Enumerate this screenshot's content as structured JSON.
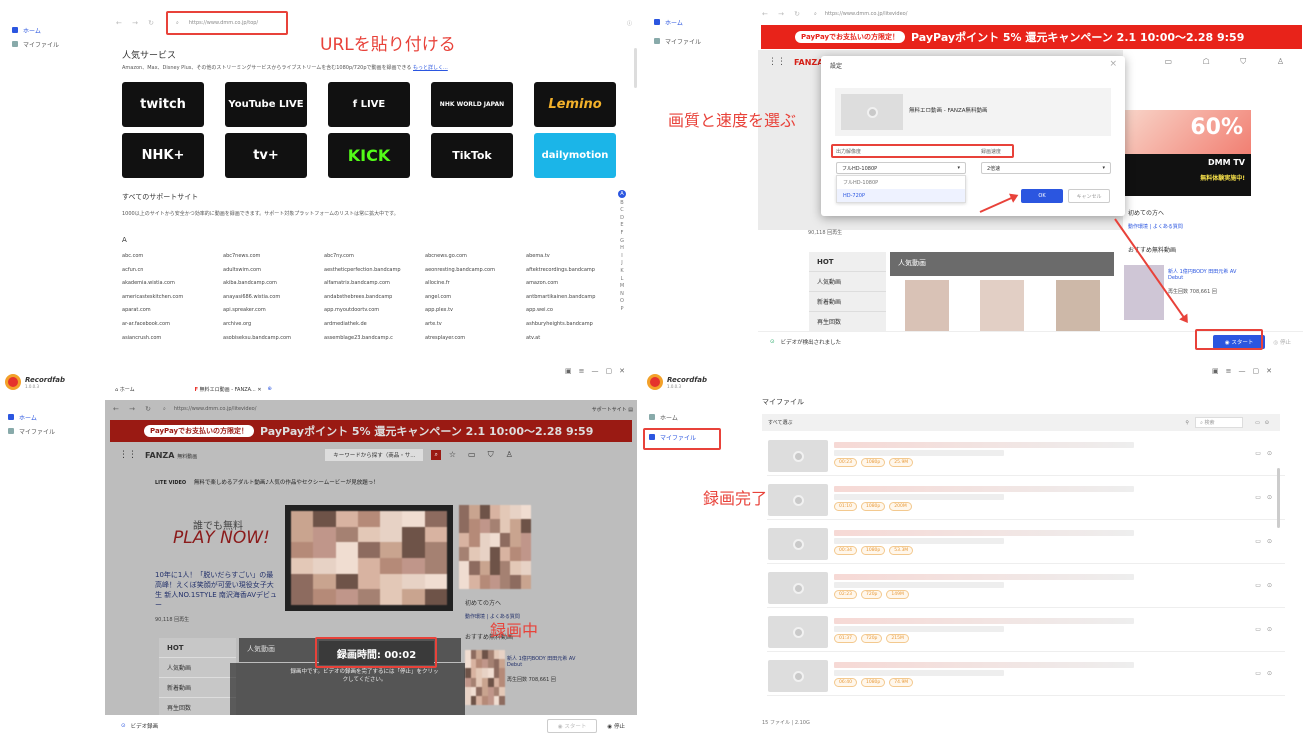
{
  "q1": {
    "sidebar": [
      "ホーム",
      "マイファイル"
    ],
    "url": "https://www.dmm.co.jp/top/",
    "callout": "URLを貼り付ける",
    "section_title": "人気サービス",
    "section_desc": "Amazon、Max、Disney Plus、その他のストリーミングサービスからライブストリームを含む1080p/720pで動画を録画できる",
    "more": "もっと詳しく...",
    "tiles": [
      "twitch",
      "YouTube LIVE",
      "f LIVE",
      "NHK WORLD JAPAN",
      "Lemino",
      "NHK+",
      "tv+",
      "KICK",
      "TikTok",
      "dailymotion"
    ],
    "all_title": "すべてのサポートサイト",
    "all_desc": "1000以上のサイトから安全かつ効率的に動画を録画できます。サポート対象プラットフォームのリストは常に拡大中です。",
    "letter": "A",
    "alphabet": [
      "A",
      "B",
      "C",
      "D",
      "E",
      "F",
      "G",
      "H",
      "I",
      "J",
      "K",
      "L",
      "M",
      "N",
      "O",
      "P"
    ],
    "sites": [
      "abc.com",
      "abc7news.com",
      "abc7ny.com",
      "abcnews.go.com",
      "abema.tv",
      "acfun.cn",
      "adultswim.com",
      "aesthetic​perfection.bandcamp",
      "aeonresting.bandcamp.com",
      "aftektrecordings.bandcamp",
      "akademia.wistia.com",
      "akiba.bandcamp.com",
      "alfamatrix.bandcamp.com",
      "allocine.fr",
      "amazon.com",
      "americasteskitchen.com",
      "anayasi686.wistia.com",
      "andabsthebrees.bandcamp",
      "angel.com",
      "antbmartikainen.bandcamp",
      "aparat.com",
      "api.spreaker.com",
      "app.myoutdoortv.com",
      "app.plex.tv",
      "app.wei.co",
      "ar-ar.facebook.com",
      "archive.org",
      "ardmediathek.de",
      "arte.tv",
      "ashburyheights.bandcamp",
      "asiancrush.com",
      "asobiseksu.bandcamp.com",
      "assemblage23.bandcamp.c",
      "atresplayer.com",
      "atv.at"
    ]
  },
  "q2": {
    "sidebar": [
      "ホーム",
      "マイファイル"
    ],
    "url": "https://www.dmm.co.jp/litevideo/",
    "banner_pill": "PayPayでお支払いの方限定！",
    "banner_main": "PayPayポイント 5% 還元キャンペーン 2.1 10:00〜2.28 9:59",
    "callout": "画質と速度を選ぶ",
    "dialog_title": "設定",
    "video_title": "無料エロ動画 - FANZA無料動画",
    "res_label": "出力解像度",
    "speed_label": "録画速度",
    "res_value": "フルHD-1080P",
    "speed_value": "2倍速",
    "res_options": [
      "フルHD-1080P",
      "HD-720P"
    ],
    "ok": "OK",
    "cancel": "キャンセル",
    "detected": "ビデオが検出されました",
    "start": "スタート",
    "stop": "停止",
    "promo_big": "60%",
    "promo_label": "DMM TV",
    "promo_sub": "無料体験実施中!",
    "first_time": "初めての方へ",
    "faq": "動作環境 | よくある質問",
    "free_videos": "おすすめ無料動画",
    "hot": "HOT",
    "popular": "人気動画",
    "hot_items": [
      "人気動画",
      "新着動画",
      "再生回数"
    ],
    "views": "90,118 回再生",
    "side_item": "新人 1億円BODY 田田元希 AV Debut",
    "side_views": "再生回数 708,661 回"
  },
  "q3": {
    "app_name": "Recordfab",
    "app_ver": "1.0.0.3",
    "sidebar": [
      "ホーム",
      "マイファイル"
    ],
    "tab_home": "ホーム",
    "tab_video": "無料エロ動画 - FANZA...",
    "url": "https://www.dmm.co.jp/litevideo/",
    "support": "サポートサイト",
    "fanza_sub": "無料動画",
    "search_placeholder": "キーワードから探す（商品・サ...",
    "lite": "LITE VIDEO",
    "lite_desc": "無料で楽しめるアダルト動画♪人気の作品やセクシームービーが見放題っ！",
    "free_text": "誰でも無料",
    "play_now": "PLAY NOW!",
    "article": "10年に1人！「脱いだらすごい」の最高峰！えくぼ笑顔が可愛い現役女子大生 新人NO.1STYLE 南沢海香AVデビュー",
    "views": "90,118 回再生",
    "rec_time": "録画時間: 00:02",
    "callout": "録画中",
    "overlay_msg": "録画中です。ビデオの録画を完了するには「停止」をクリックしてください。",
    "first_time": "初めての方へ",
    "faq": "動作環境 | よくある質問",
    "recommend": "おすすめ無料動画",
    "side_item": "新人 1億円BODY 田田元希 AV Debut",
    "side_views": "再生回数 708,661 回",
    "hot": "HOT",
    "popular": "人気動画",
    "hot_items": [
      "人気動画",
      "新着動画",
      "再生回数"
    ],
    "record_btn": "ビデオ録画",
    "start": "スタート",
    "stop": "停止"
  },
  "q4": {
    "app_name": "Recordfab",
    "app_ver": "1.0.0.3",
    "sidebar": [
      "ホーム",
      "マイファイル"
    ],
    "page_title": "マイファイル",
    "select_all": "すべて選ぶ",
    "search_placeholder": "検索",
    "callout": "録画完了",
    "rows": [
      [
        "00:23",
        "1080p",
        "25.9M"
      ],
      [
        "01:10",
        "1080p",
        "200M"
      ],
      [
        "00:34",
        "1080p",
        "53.3M"
      ],
      [
        "02:23",
        "720p",
        "149M"
      ],
      [
        "01:37",
        "720p",
        "215M"
      ],
      [
        "06:40",
        "1080p",
        "74.9M"
      ]
    ],
    "footer": "15 ファイル | 2.10G"
  },
  "colors": {
    "accent": "#2b56e0",
    "callout": "#e8423a",
    "banner": "#e8231a"
  }
}
